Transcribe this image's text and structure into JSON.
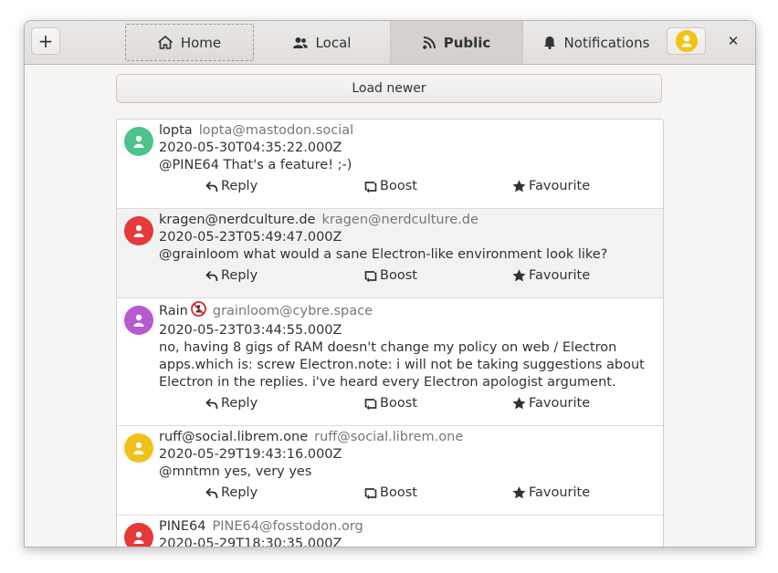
{
  "header": {
    "add_label": "+",
    "close_label": "✕",
    "tabs": [
      {
        "label": "Home",
        "icon": "home-icon"
      },
      {
        "label": "Local",
        "icon": "users-icon"
      },
      {
        "label": "Public",
        "icon": "rss-icon",
        "active": true
      },
      {
        "label": "Notifications",
        "icon": "bell-icon"
      }
    ]
  },
  "feed": {
    "load_newer_label": "Load newer",
    "actions": {
      "reply": "Reply",
      "boost": "Boost",
      "favourite": "Favourite"
    },
    "posts": [
      {
        "name": "lopta",
        "acct": "lopta@mastodon.social",
        "date": "2020-05-30T04:35:22.000Z",
        "text": "@PINE64 That's a feature! ;-)",
        "avatar_color": "#4cc38a"
      },
      {
        "name": "kragen@nerdculture.de",
        "acct": "kragen@nerdculture.de",
        "date": "2020-05-23T05:49:47.000Z",
        "text": "@grainloom what would a sane Electron-like environment look like?",
        "avatar_color": "#e5393a"
      },
      {
        "name": "Rain",
        "acct": "grainloom@cybre.space",
        "date": "2020-05-23T03:44:55.000Z",
        "text": "no, having 8 gigs of RAM doesn't change my policy on web / Electron apps.which is: screw Electron.note: i will not be taking suggestions about Electron in the replies. i've heard every Electron apologist argument.",
        "avatar_color": "#b75ad2"
      },
      {
        "name": "ruff@social.librem.one",
        "acct": "ruff@social.librem.one",
        "date": "2020-05-29T19:43:16.000Z",
        "text": "@mntmn yes, very yes",
        "avatar_color": "#f2c01b"
      },
      {
        "name": "PINE64",
        "acct": "PINE64@fosstodon.org",
        "date": "2020-05-29T18:30:35.000Z",
        "text": "",
        "avatar_color": "#e5393a"
      }
    ]
  },
  "colors": {
    "avatar_self": "#f5c211"
  }
}
